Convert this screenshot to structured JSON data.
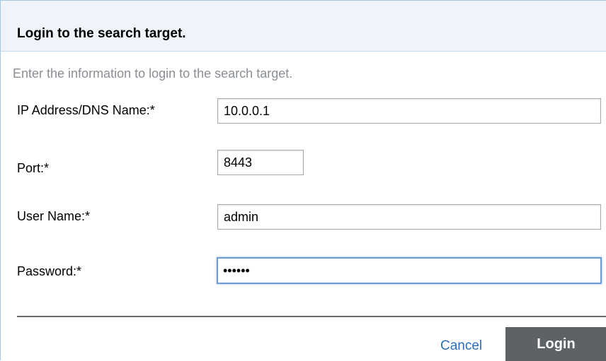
{
  "dialog": {
    "title": "Login to the search target.",
    "description": "Enter the information to login to the search target."
  },
  "form": {
    "ip": {
      "label": "IP Address/DNS Name:*",
      "value": "10.0.0.1"
    },
    "port": {
      "label": "Port:*",
      "value": "8443"
    },
    "username": {
      "label": "User Name:*",
      "value": "admin"
    },
    "password": {
      "label": "Password:*",
      "value": "••••••"
    }
  },
  "actions": {
    "cancel_label": "Cancel",
    "login_label": "Login"
  },
  "colors": {
    "header_background": "#eef4fa",
    "link": "#2a6ebb",
    "login_button": "#5d6267",
    "focus_border": "#6e9bd3"
  }
}
